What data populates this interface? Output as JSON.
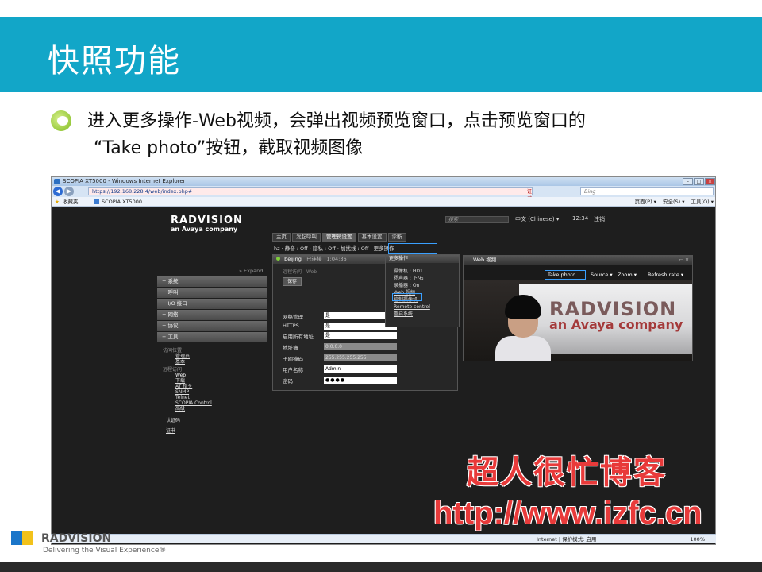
{
  "slide": {
    "title": "快照功能",
    "bullet_line1": "进入更多操作-Web视频，会弹出视频预览窗口，点击预览窗口的",
    "bullet_line2": "“Take photo”按钮，截取视频图像"
  },
  "browser": {
    "window_title": "SCOPIA XT5000 - Windows Internet Explorer",
    "url": "https://192.168.228.4/web/index.php#",
    "cert_error": "证书错误",
    "search_placeholder": "Bing",
    "favorites_label": "收藏夹",
    "tab_label": "SCOPIA XT5000",
    "tools": [
      "页面(P) ▾",
      "安全(S) ▾",
      "工具(O) ▾"
    ],
    "status_zone": "Internet | 保护模式: 启用",
    "zoom": "100%"
  },
  "app": {
    "logo": "RADVISION",
    "logo_sub": "an Avaya company",
    "search_placeholder": "搜索",
    "language": "中文 (Chinese) ▾",
    "time": "12:34",
    "logout": "注销",
    "tabs": [
      "主页",
      "发起呼叫",
      "管理员设置",
      "基本设置",
      "诊断"
    ],
    "breadcrumb": "hz · 静音 : Off · 隐私 : Off · 加扰线 : Off · 更多操作",
    "expand": "» Expand",
    "side_nav": [
      "+ 系统",
      "+ 呼叫",
      "+ I/O 接口",
      "+ 网络",
      "+ 协议",
      "− 工具"
    ],
    "side_tools": {
      "group1": "访问位置",
      "group1_items": [
        "管理员",
        "基本"
      ],
      "group2": "远程访问",
      "group2_active": "Web",
      "group2_items": [
        "下载",
        "AT 指令",
        "SNMP",
        "Telnet",
        "SCOPIA Control",
        "高级"
      ],
      "bottom": [
        "认证码",
        "证书"
      ]
    }
  },
  "call": {
    "name": "beijing",
    "status": "已连接",
    "duration": "1:04:36",
    "section": "远程访问 - Web",
    "save": "保存",
    "fields": [
      {
        "label": "网络管理",
        "value": "是"
      },
      {
        "label": "HTTPS",
        "value": "是"
      },
      {
        "label": "启用所有地址",
        "value": "是"
      },
      {
        "label": "地址簿",
        "value": "0.0.0.0"
      },
      {
        "label": "子网掩码",
        "value": "255.255.255.255"
      },
      {
        "label": "用户名称",
        "value": "Admin"
      },
      {
        "label": "密码",
        "value": "●●●●"
      }
    ]
  },
  "more_ops": {
    "title": "更多操作",
    "rows": [
      "摄像机 : HD1",
      "扬声器 : 下/右",
      "录播器 : On"
    ],
    "links": [
      "Web 视频",
      "控制摄像机",
      "Remote control",
      "重启系统"
    ]
  },
  "video": {
    "title": "Web 视频",
    "take_photo": "Take photo",
    "source": "Source ▾",
    "zoom": "Zoom ▾",
    "refresh": "Refresh rate ▾",
    "wall_text1": "RADVISION",
    "wall_text2": "an Avaya company"
  },
  "watermark": {
    "line1": "超人很忙博客",
    "line2": "http://www.izfc.cn"
  },
  "footer": {
    "brand": "RADVISION",
    "tagline": "Delivering the Visual Experience®"
  }
}
